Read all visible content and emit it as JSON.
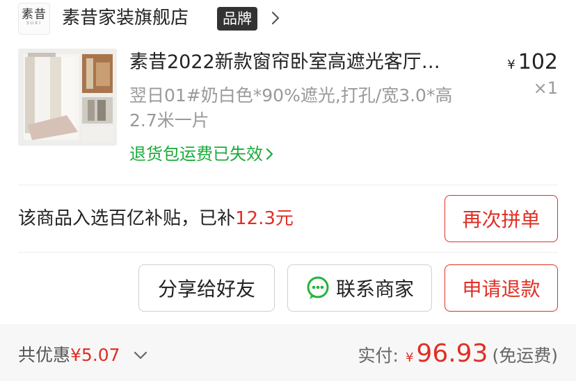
{
  "shop": {
    "logo_cn": "素昔",
    "logo_en": "SUXI",
    "name": "素昔家装旗舰店",
    "badge": "品牌"
  },
  "product": {
    "title": "素昔2022新款窗帘卧室高遮光客厅…",
    "price_symbol": "¥",
    "price": "102",
    "quantity": "×1",
    "spec_line1": "翌日01#奶白色*90%遮光,打孔/宽3.0*高",
    "spec_line2": "2.7米一片",
    "return_link": "退货包运费已失效"
  },
  "subsidy": {
    "text": "该商品入选百亿补贴，已补",
    "amount": "12.3元"
  },
  "buttons": {
    "reorder": "再次拼单",
    "share": "分享给好友",
    "contact": "联系商家",
    "refund": "申请退款"
  },
  "footer": {
    "discount_label": "共优惠",
    "discount_value": "¥5.07",
    "paid_label": "实付:",
    "paid_symbol": "¥",
    "paid_amount": "96.93",
    "shipping": "(免运费)"
  },
  "colors": {
    "accent_red": "#e02e24",
    "link_green": "#1aab3a",
    "wechat_green": "#23b33c"
  }
}
